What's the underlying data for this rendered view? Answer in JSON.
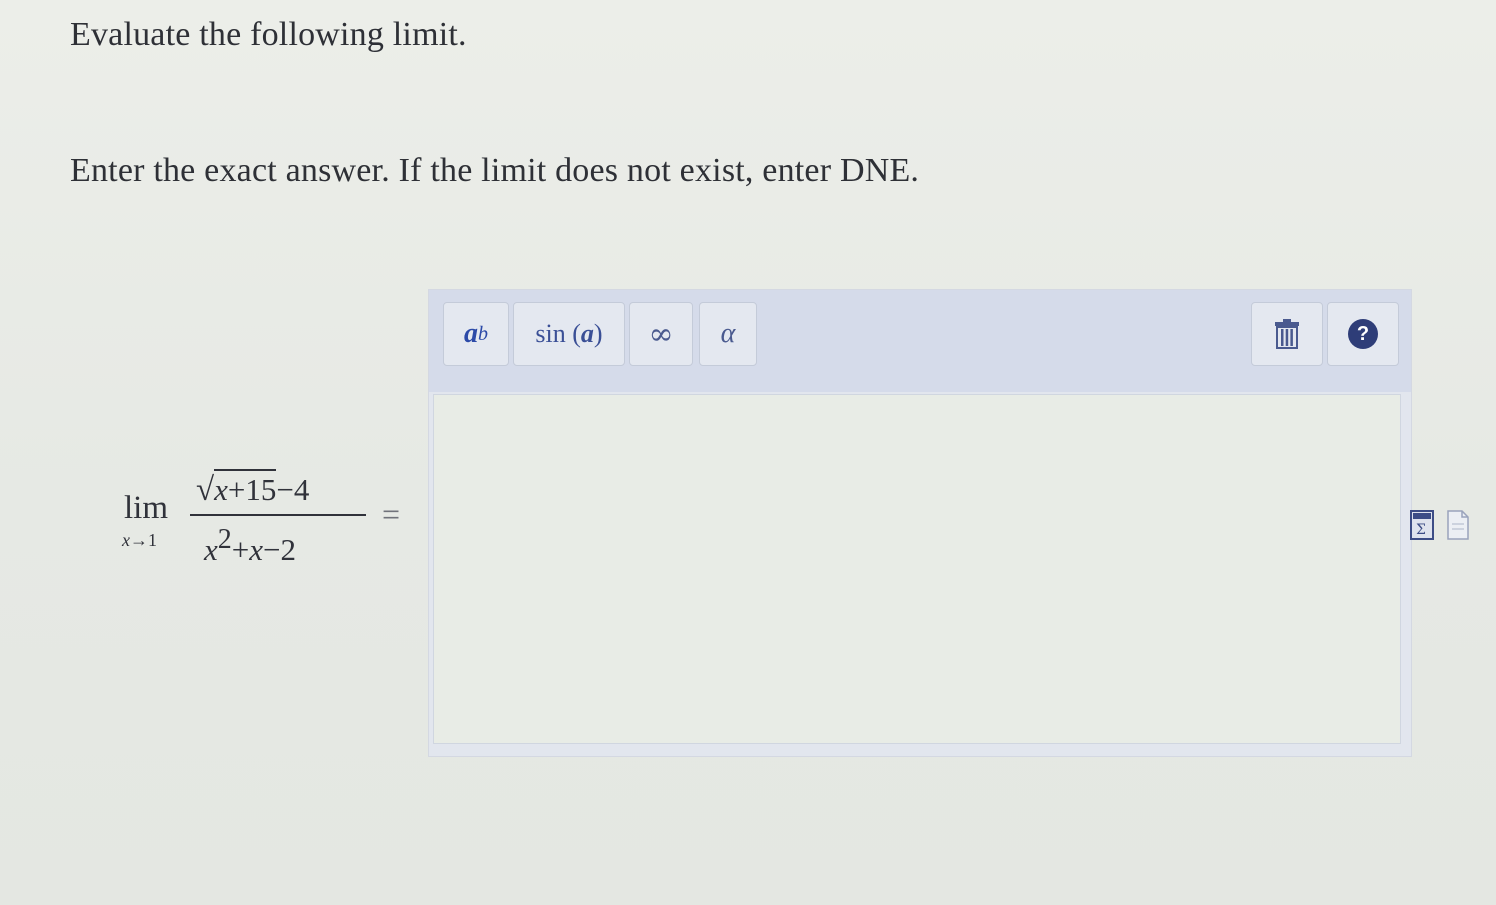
{
  "question": {
    "title": "Evaluate the following limit.",
    "instructions": "Enter the exact answer. If the limit does not exist, enter DNE."
  },
  "expression": {
    "lim_word": "lim",
    "lim_sub_var": "x",
    "lim_sub_arrow": "→",
    "lim_sub_value": "1",
    "numerator_radicand_var": "x",
    "numerator_radicand_rest": "+15",
    "numerator_rest": "−4",
    "denominator_var1": "x",
    "denominator_exp": "2",
    "denominator_plus": "+",
    "denominator_var2": "x",
    "denominator_rest": "−2",
    "equals": "="
  },
  "editor": {
    "toolbar": {
      "power_base": "a",
      "power_exp": "b",
      "sin_label_fn": "sin",
      "sin_label_arg": "a",
      "infinity_label": "∞",
      "alpha_label": "α",
      "help_label": "?"
    },
    "answer_value": ""
  },
  "icons": {
    "trash": "trash-icon",
    "help": "help-icon",
    "equation": "equation-icon",
    "file": "file-icon"
  },
  "colors": {
    "toolbar_bg": "#d5dbea",
    "button_text": "#3b4f8f",
    "help_circle": "#2e3d78"
  }
}
